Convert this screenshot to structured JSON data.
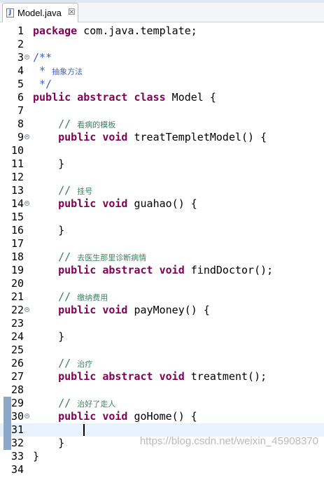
{
  "tab": {
    "icon": "java-file-icon",
    "title": "Model.java",
    "close": "☒"
  },
  "watermark": "https://blog.csdn.net/weixin_45908370",
  "current_line": 31,
  "lines": [
    {
      "n": "1",
      "fold": false,
      "mark": false,
      "tokens": [
        [
          "kw",
          "package"
        ],
        [
          "pl",
          " com.java.template;"
        ]
      ]
    },
    {
      "n": "2",
      "fold": false,
      "mark": false,
      "tokens": []
    },
    {
      "n": "3",
      "fold": true,
      "mark": false,
      "tokens": [
        [
          "jd",
          "/**"
        ]
      ]
    },
    {
      "n": "4",
      "fold": false,
      "mark": false,
      "tokens": [
        [
          "jd",
          " * "
        ],
        [
          "jdcn",
          "抽象方法"
        ]
      ]
    },
    {
      "n": "5",
      "fold": false,
      "mark": false,
      "tokens": [
        [
          "jd",
          " */"
        ]
      ]
    },
    {
      "n": "6",
      "fold": false,
      "mark": false,
      "tokens": [
        [
          "kw",
          "public abstract class"
        ],
        [
          "pl",
          " Model {"
        ]
      ]
    },
    {
      "n": "7",
      "fold": false,
      "mark": false,
      "tokens": []
    },
    {
      "n": "8",
      "fold": false,
      "mark": false,
      "tokens": [
        [
          "pl",
          "    "
        ],
        [
          "cm",
          "// "
        ],
        [
          "cmcn",
          "看病的模板"
        ]
      ]
    },
    {
      "n": "9",
      "fold": true,
      "mark": false,
      "tokens": [
        [
          "pl",
          "    "
        ],
        [
          "kw",
          "public void"
        ],
        [
          "pl",
          " treatTempletModel() {"
        ]
      ]
    },
    {
      "n": "10",
      "fold": false,
      "mark": false,
      "tokens": []
    },
    {
      "n": "11",
      "fold": false,
      "mark": false,
      "tokens": [
        [
          "pl",
          "    }"
        ]
      ]
    },
    {
      "n": "12",
      "fold": false,
      "mark": false,
      "tokens": []
    },
    {
      "n": "13",
      "fold": false,
      "mark": false,
      "tokens": [
        [
          "pl",
          "    "
        ],
        [
          "cm",
          "// "
        ],
        [
          "cmcn",
          "挂号"
        ]
      ]
    },
    {
      "n": "14",
      "fold": true,
      "mark": false,
      "tokens": [
        [
          "pl",
          "    "
        ],
        [
          "kw",
          "public void"
        ],
        [
          "pl",
          " guahao() {"
        ]
      ]
    },
    {
      "n": "15",
      "fold": false,
      "mark": false,
      "tokens": []
    },
    {
      "n": "16",
      "fold": false,
      "mark": false,
      "tokens": [
        [
          "pl",
          "    }"
        ]
      ]
    },
    {
      "n": "17",
      "fold": false,
      "mark": false,
      "tokens": []
    },
    {
      "n": "18",
      "fold": false,
      "mark": false,
      "tokens": [
        [
          "pl",
          "    "
        ],
        [
          "cm",
          "// "
        ],
        [
          "cmcn",
          "去医生那里诊断病情"
        ]
      ]
    },
    {
      "n": "19",
      "fold": false,
      "mark": false,
      "tokens": [
        [
          "pl",
          "    "
        ],
        [
          "kw",
          "public abstract void"
        ],
        [
          "pl",
          " findDoctor();"
        ]
      ]
    },
    {
      "n": "20",
      "fold": false,
      "mark": false,
      "tokens": []
    },
    {
      "n": "21",
      "fold": false,
      "mark": false,
      "tokens": [
        [
          "pl",
          "    "
        ],
        [
          "cm",
          "// "
        ],
        [
          "cmcn",
          "缴纳费用"
        ]
      ]
    },
    {
      "n": "22",
      "fold": true,
      "mark": false,
      "tokens": [
        [
          "pl",
          "    "
        ],
        [
          "kw",
          "public void"
        ],
        [
          "pl",
          " payMoney() {"
        ]
      ]
    },
    {
      "n": "23",
      "fold": false,
      "mark": false,
      "tokens": []
    },
    {
      "n": "24",
      "fold": false,
      "mark": false,
      "tokens": [
        [
          "pl",
          "    }"
        ]
      ]
    },
    {
      "n": "25",
      "fold": false,
      "mark": false,
      "tokens": []
    },
    {
      "n": "26",
      "fold": false,
      "mark": false,
      "tokens": [
        [
          "pl",
          "    "
        ],
        [
          "cm",
          "// "
        ],
        [
          "cmcn",
          "治疗"
        ]
      ]
    },
    {
      "n": "27",
      "fold": false,
      "mark": false,
      "tokens": [
        [
          "pl",
          "    "
        ],
        [
          "kw",
          "public abstract void"
        ],
        [
          "pl",
          " treatment();"
        ]
      ]
    },
    {
      "n": "28",
      "fold": false,
      "mark": false,
      "tokens": []
    },
    {
      "n": "29",
      "fold": false,
      "mark": true,
      "tokens": [
        [
          "pl",
          "    "
        ],
        [
          "cm",
          "// "
        ],
        [
          "cmcn",
          "治好了走人"
        ]
      ]
    },
    {
      "n": "30",
      "fold": true,
      "mark": true,
      "tokens": [
        [
          "pl",
          "    "
        ],
        [
          "kw",
          "public void"
        ],
        [
          "pl",
          " goHome() {"
        ]
      ]
    },
    {
      "n": "31",
      "fold": false,
      "mark": true,
      "tokens": []
    },
    {
      "n": "32",
      "fold": false,
      "mark": true,
      "tokens": [
        [
          "pl",
          "    }"
        ]
      ]
    },
    {
      "n": "33",
      "fold": false,
      "mark": false,
      "tokens": [
        [
          "pl",
          "}"
        ]
      ]
    },
    {
      "n": "34",
      "fold": false,
      "mark": false,
      "tokens": []
    }
  ]
}
